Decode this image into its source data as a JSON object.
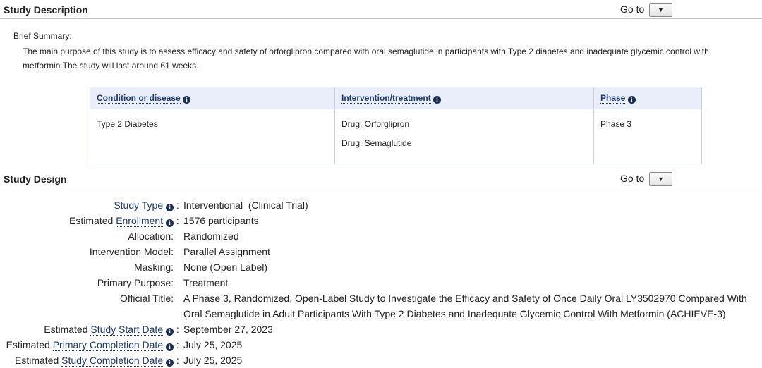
{
  "study_description": {
    "title": "Study Description",
    "goto_label": "Go to",
    "goto_button": "▼",
    "brief_summary_label": "Brief Summary:",
    "brief_summary_text": "The main purpose of this study is to assess efficacy and safety of orforglipron compared with oral semaglutide in participants with Type 2 diabetes and inadequate glycemic control with metformin.The study will last around 61 weeks.",
    "table": {
      "headers": [
        "Condition or disease",
        "Intervention/treatment",
        "Phase"
      ],
      "condition": "Type 2 Diabetes",
      "interventions": [
        "Drug: Orforglipron",
        "Drug: Semaglutide"
      ],
      "phase": "Phase 3"
    }
  },
  "study_design": {
    "title": "Study Design",
    "goto_label": "Go to",
    "goto_button": "▼",
    "rows": {
      "study_type": {
        "prefix": "",
        "link": "Study Type",
        "value": "Interventional  (Clinical Trial)"
      },
      "enrollment": {
        "prefix": "Estimated ",
        "link": "Enrollment",
        "value": "1576 participants"
      },
      "allocation": {
        "label": "Allocation:",
        "value": "Randomized"
      },
      "model": {
        "label": "Intervention Model:",
        "value": "Parallel Assignment"
      },
      "masking": {
        "label": "Masking:",
        "value": "None (Open Label)"
      },
      "purpose": {
        "label": "Primary Purpose:",
        "value": "Treatment"
      },
      "official_title": {
        "label": "Official Title:",
        "value": "A Phase 3, Randomized, Open-Label Study to Investigate the Efficacy and Safety of Once Daily Oral LY3502970 Compared With Oral Semaglutide in Adult Participants With Type 2 Diabetes and Inadequate Glycemic Control With Metformin (ACHIEVE-3)"
      },
      "start_date": {
        "prefix": "Estimated ",
        "link": "Study Start Date",
        "value": "September 27, 2023"
      },
      "primary_completion": {
        "prefix": "Estimated ",
        "link": "Primary Completion Date",
        "value": "July 25, 2025"
      },
      "study_completion": {
        "prefix": "Estimated ",
        "link": "Study Completion Date",
        "value": "July 25, 2025"
      }
    }
  },
  "info_icon_glyph": "i"
}
